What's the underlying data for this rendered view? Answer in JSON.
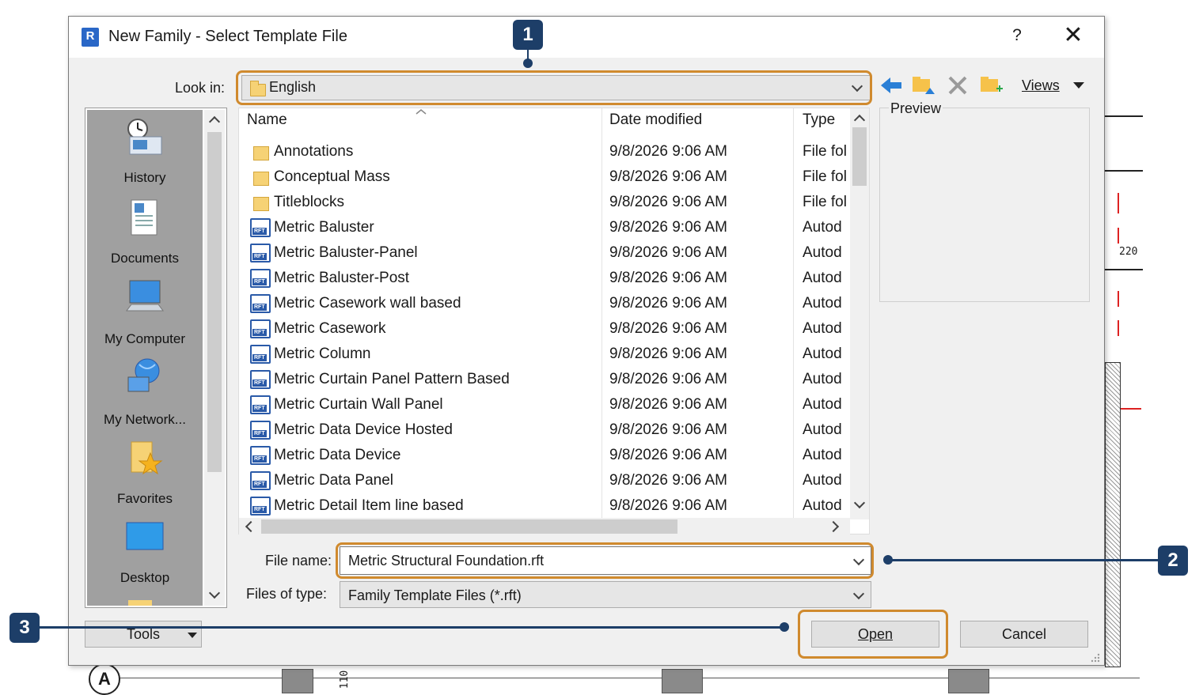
{
  "dialog": {
    "app_icon": "R",
    "title": "New Family - Select Template File",
    "help": "?",
    "close": "✕"
  },
  "look_in": {
    "label": "Look in:",
    "value": "English"
  },
  "toolbar": {
    "icons": [
      "back-arrow-icon",
      "up-folder-icon",
      "delete-icon",
      "new-folder-icon"
    ],
    "views_label": "Views"
  },
  "places": [
    {
      "label": "History",
      "icon": "history-icon"
    },
    {
      "label": "Documents",
      "icon": "documents-icon"
    },
    {
      "label": "My Computer",
      "icon": "computer-icon"
    },
    {
      "label": "My Network...",
      "icon": "network-icon"
    },
    {
      "label": "Favorites",
      "icon": "favorites-icon"
    },
    {
      "label": "Desktop",
      "icon": "desktop-icon"
    }
  ],
  "file_list": {
    "columns": [
      "Name",
      "Date modified",
      "Type"
    ],
    "rows": [
      {
        "name": "Annotations",
        "date": "9/8/2026 9:06 AM",
        "type": "File fol",
        "kind": "folder"
      },
      {
        "name": "Conceptual Mass",
        "date": "9/8/2026 9:06 AM",
        "type": "File fol",
        "kind": "folder"
      },
      {
        "name": "Titleblocks",
        "date": "9/8/2026 9:06 AM",
        "type": "File fol",
        "kind": "folder"
      },
      {
        "name": "Metric Baluster",
        "date": "9/8/2026 9:06 AM",
        "type": "Autod",
        "kind": "rft"
      },
      {
        "name": "Metric Baluster-Panel",
        "date": "9/8/2026 9:06 AM",
        "type": "Autod",
        "kind": "rft"
      },
      {
        "name": "Metric Baluster-Post",
        "date": "9/8/2026 9:06 AM",
        "type": "Autod",
        "kind": "rft"
      },
      {
        "name": "Metric Casework wall based",
        "date": "9/8/2026 9:06 AM",
        "type": "Autod",
        "kind": "rft"
      },
      {
        "name": "Metric Casework",
        "date": "9/8/2026 9:06 AM",
        "type": "Autod",
        "kind": "rft"
      },
      {
        "name": "Metric Column",
        "date": "9/8/2026 9:06 AM",
        "type": "Autod",
        "kind": "rft"
      },
      {
        "name": "Metric Curtain Panel Pattern Based",
        "date": "9/8/2026 9:06 AM",
        "type": "Autod",
        "kind": "rft"
      },
      {
        "name": "Metric Curtain Wall Panel",
        "date": "9/8/2026 9:06 AM",
        "type": "Autod",
        "kind": "rft"
      },
      {
        "name": "Metric Data Device Hosted",
        "date": "9/8/2026 9:06 AM",
        "type": "Autod",
        "kind": "rft"
      },
      {
        "name": "Metric Data Device",
        "date": "9/8/2026 9:06 AM",
        "type": "Autod",
        "kind": "rft"
      },
      {
        "name": "Metric Data Panel",
        "date": "9/8/2026 9:06 AM",
        "type": "Autod",
        "kind": "rft"
      },
      {
        "name": "Metric Detail Item line based",
        "date": "9/8/2026 9:06 AM",
        "type": "Autod",
        "kind": "rft"
      }
    ]
  },
  "preview": {
    "label": "Preview"
  },
  "file_name": {
    "label": "File name:",
    "value": "Metric Structural Foundation.rft"
  },
  "file_type": {
    "label": "Files of type:",
    "value": "Family Template Files (*.rft)"
  },
  "buttons": {
    "tools": "Tools",
    "open": "Open",
    "cancel": "Cancel"
  },
  "callouts": {
    "one": "1",
    "two": "2",
    "three": "3"
  },
  "drawing": {
    "grid_label": "A",
    "dim_220": "220",
    "dim_110": "110"
  },
  "colors": {
    "callout_badge": "#1d3e68",
    "highlight": "#d08a2e",
    "places_bg": "#a0a0a0"
  }
}
